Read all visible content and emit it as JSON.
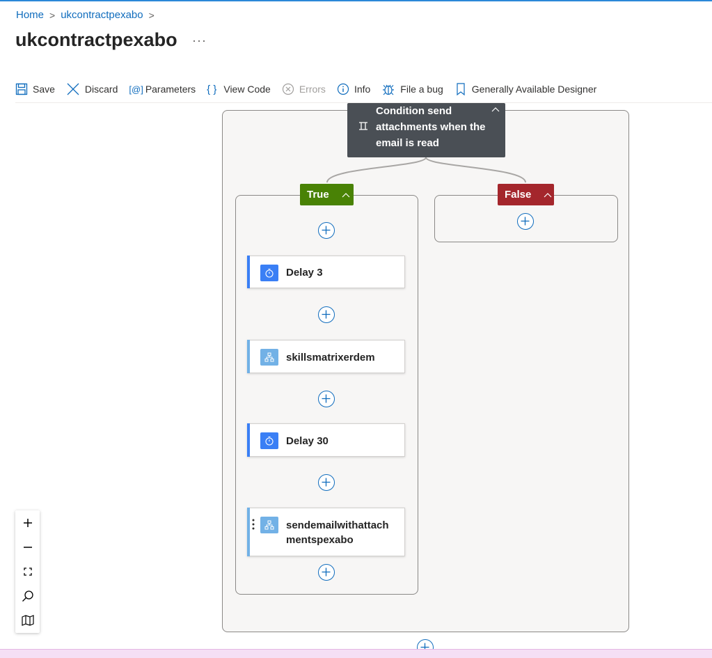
{
  "breadcrumb": {
    "home": "Home",
    "separator": ">",
    "current": "ukcontractpexabo"
  },
  "page": {
    "title": "ukcontractpexabo",
    "more": "···"
  },
  "toolbar": {
    "save": "Save",
    "discard": "Discard",
    "parameters": "Parameters",
    "parameters_glyph": "[@]",
    "view_code": "View Code",
    "view_code_glyph": "{ }",
    "errors": "Errors",
    "info": "Info",
    "file_a_bug": "File a bug",
    "designer": "Generally Available Designer"
  },
  "condition": {
    "label": "Condition send attachments when the email is read",
    "icon": "condition-icon",
    "caret": "^"
  },
  "branches": {
    "true_label": "True",
    "false_label": "False",
    "caret": "^",
    "true_color": "#498205",
    "false_color": "#a4262c"
  },
  "actions": [
    {
      "label": "Delay 3",
      "icon": "timer-icon",
      "color": "#3a7ff5"
    },
    {
      "label": "skillsmatrixerdem",
      "icon": "workflow-icon",
      "color": "#72b1e6"
    },
    {
      "label": "Delay 30",
      "icon": "timer-icon",
      "color": "#3a7ff5"
    },
    {
      "label": "sendemailwithattachmentspexabo",
      "label_line1": "sendemailwithattach",
      "label_line2": "mentspexabo",
      "icon": "workflow-icon",
      "color": "#72b1e6"
    }
  ],
  "zoom_controls": [
    "zoom-in",
    "zoom-out",
    "fit-view",
    "search",
    "minimap"
  ],
  "colors": {
    "accent": "#0f6cbd",
    "condition_bg": "#4a4f55"
  }
}
